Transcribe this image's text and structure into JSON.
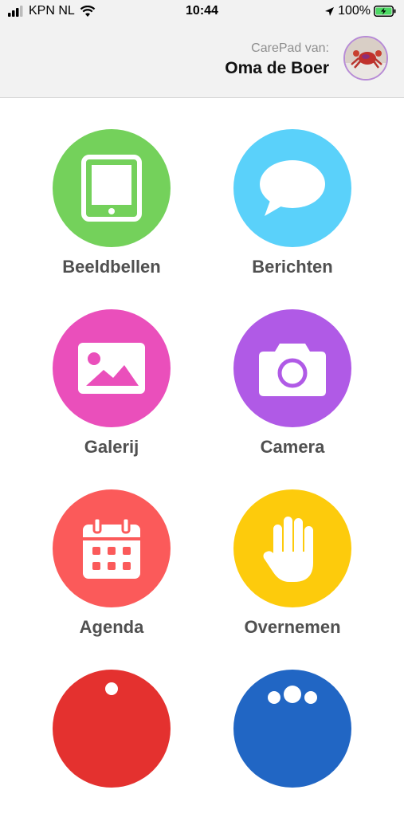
{
  "status": {
    "carrier": "KPN NL",
    "time": "10:44",
    "battery": "100%"
  },
  "header": {
    "subtitle": "CarePad van:",
    "name": "Oma de Boer"
  },
  "tiles": [
    {
      "label": "Beeldbellen",
      "color": "#74d15b",
      "icon": "tablet-icon"
    },
    {
      "label": "Berichten",
      "color": "#5ad1fa",
      "icon": "speech-bubble-icon"
    },
    {
      "label": "Galerij",
      "color": "#ea4fbb",
      "icon": "image-icon"
    },
    {
      "label": "Camera",
      "color": "#b05ae6",
      "icon": "camera-icon"
    },
    {
      "label": "Agenda",
      "color": "#fb5a5a",
      "icon": "calendar-icon"
    },
    {
      "label": "Overnemen",
      "color": "#fdcb0c",
      "icon": "hand-icon"
    },
    {
      "label": "",
      "color": "#e4312f",
      "icon": "bell-icon"
    },
    {
      "label": "",
      "color": "#2166c4",
      "icon": "people-icon"
    }
  ]
}
